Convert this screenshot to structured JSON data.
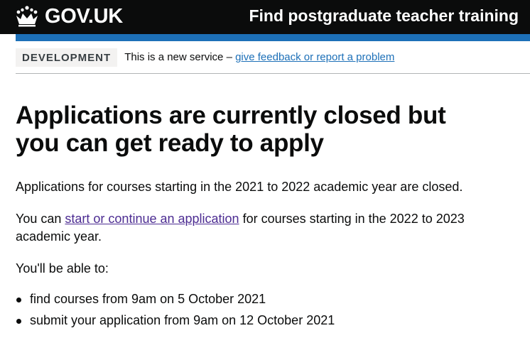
{
  "header": {
    "logo_text": "GOV.UK",
    "service_name": "Find postgraduate teacher training"
  },
  "phase_banner": {
    "tag": "DEVELOPMENT",
    "text": "This is a new service – ",
    "link": "give feedback or report a problem"
  },
  "main": {
    "heading": "Applications are currently closed but you can get ready to apply",
    "paragraph_1": "Applications for courses starting in the 2021 to 2022 academic year are closed.",
    "paragraph_2_before": "You can ",
    "paragraph_2_link": "start or continue an application",
    "paragraph_2_after": " for courses starting in the 2022 to 2023 academic year.",
    "paragraph_3": "You'll be able to:",
    "list_items": [
      "find courses from 9am on 5 October 2021",
      "submit your application from 9am on 12 October 2021"
    ]
  },
  "colors": {
    "header_bg": "#0b0c0c",
    "stripe": "#1d70b8",
    "link": "#1d70b8",
    "visited_link": "#4c2c92",
    "tag_bg": "#f3f2f1"
  },
  "icons": {
    "logo": "crown-icon"
  }
}
